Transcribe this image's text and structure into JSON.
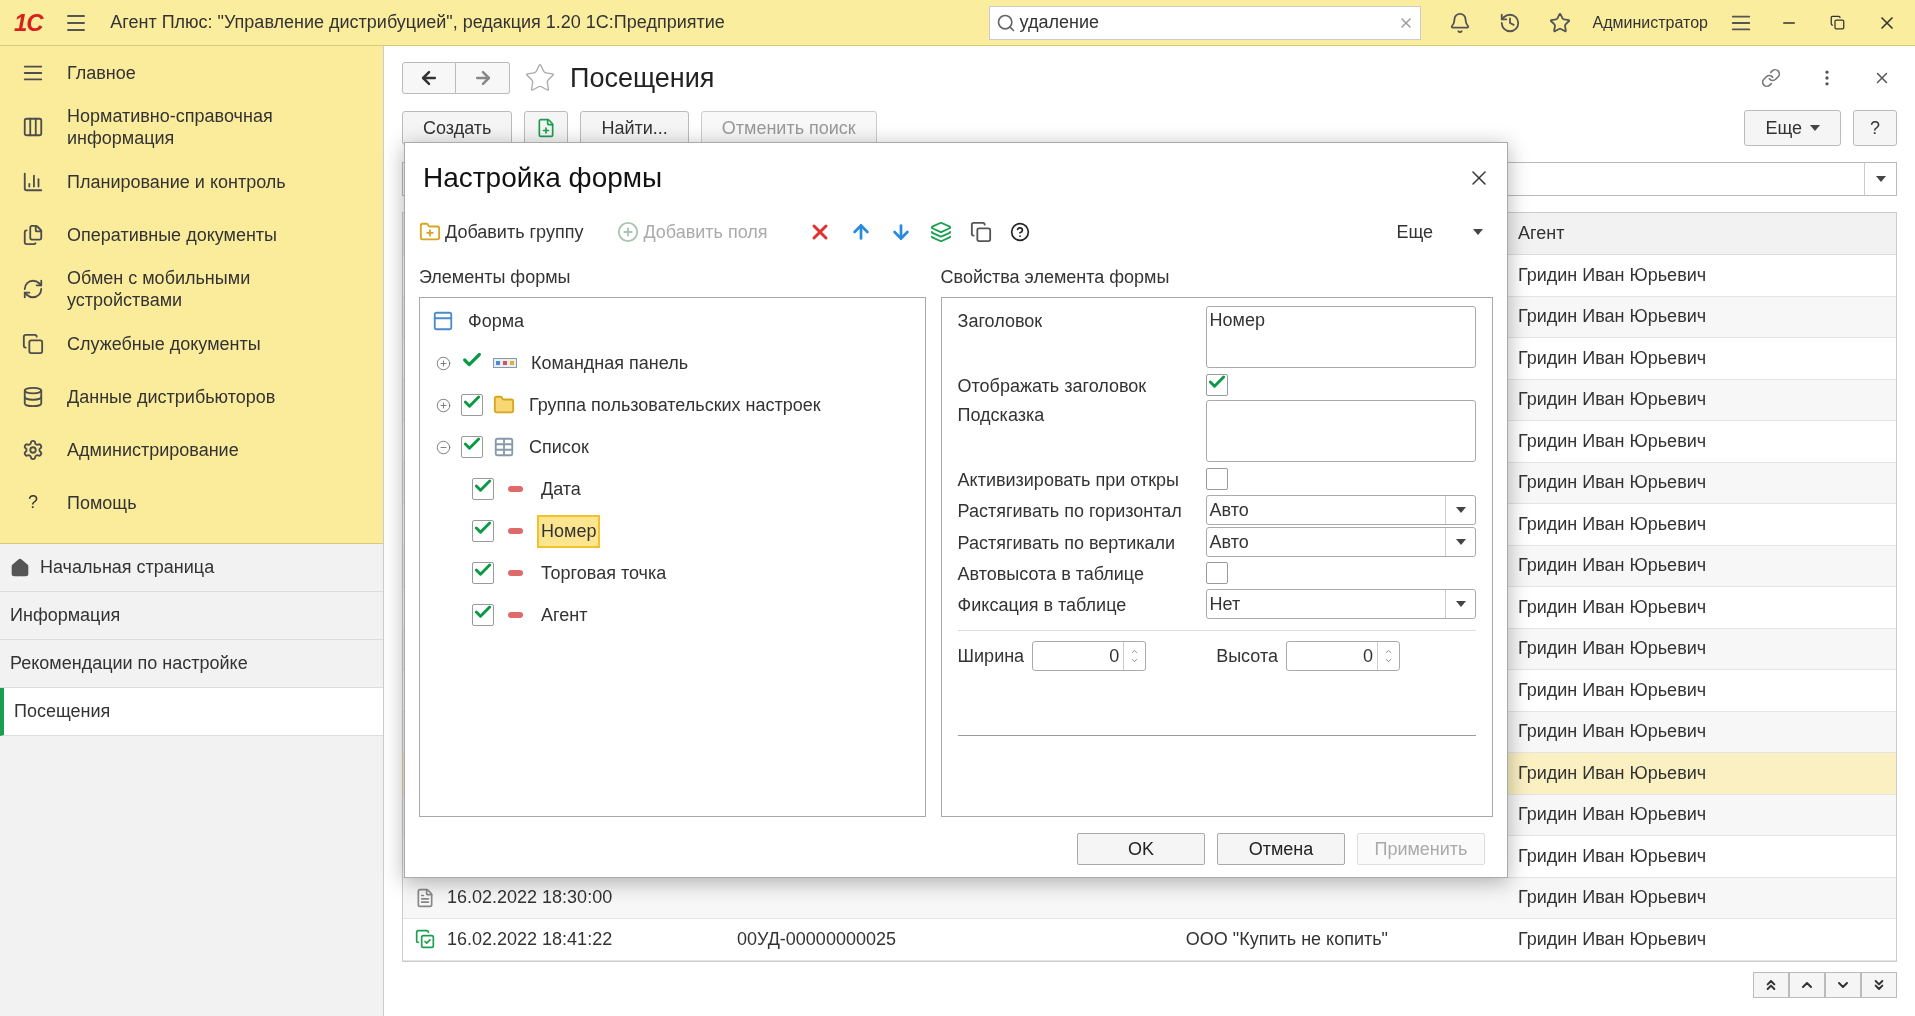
{
  "app_bar": {
    "logo": "1С",
    "title": "Агент Плюс: \"Управление дистрибуцией\", редакция 1.20 1С:Предприятие",
    "search": "удаление",
    "user": "Администратор"
  },
  "sections": [
    {
      "label": "Главное"
    },
    {
      "label": "Нормативно-справочная информация"
    },
    {
      "label": "Планирование и контроль"
    },
    {
      "label": "Оперативные документы"
    },
    {
      "label": "Обмен с мобильными устройствами"
    },
    {
      "label": "Служебные документы"
    },
    {
      "label": "Данные дистрибьюторов"
    },
    {
      "label": "Администрирование"
    },
    {
      "label": "Помощь",
      "glyph": "?"
    }
  ],
  "open_windows": [
    {
      "label": "Начальная страница",
      "selected": false,
      "home": true
    },
    {
      "label": "Информация",
      "selected": false
    },
    {
      "label": "Рекомендации по настройке",
      "selected": false
    },
    {
      "label": "Посещения",
      "selected": true
    }
  ],
  "form": {
    "title": "Посещения",
    "create": "Создать",
    "find": "Найти...",
    "cancel_search": "Отменить поиск",
    "more": "Еще",
    "help": "?",
    "agent_column": "Агент",
    "rows": [
      {
        "agent": "Гридин Иван Юрьевич",
        "selected": false
      },
      {
        "agent": "Гридин Иван Юрьевич",
        "selected": false
      },
      {
        "agent": "Гридин Иван Юрьевич",
        "selected": false
      },
      {
        "agent": "Гридин Иван Юрьевич",
        "selected": false
      },
      {
        "agent": "Гридин Иван Юрьевич",
        "selected": false
      },
      {
        "agent": "Гридин Иван Юрьевич",
        "selected": false
      },
      {
        "agent": "Гридин Иван Юрьевич",
        "selected": false
      },
      {
        "agent": "Гридин Иван Юрьевич",
        "selected": false
      },
      {
        "agent": "Гридин Иван Юрьевич",
        "selected": false
      },
      {
        "agent": "Гридин Иван Юрьевич",
        "selected": false
      },
      {
        "agent": "Гридин Иван Юрьевич",
        "selected": false
      },
      {
        "agent": "Гридин Иван Юрьевич",
        "selected": false
      },
      {
        "agent": "Гридин Иван Юрьевич",
        "selected": true
      },
      {
        "agent": "Гридин Иван Юрьевич",
        "selected": false
      },
      {
        "agent": "Гридин Иван Юрьевич",
        "selected": false
      },
      {
        "date": "16.02.2022 18:30:00",
        "agent": "Гридин Иван Юрьевич",
        "posted": false,
        "selected": false
      },
      {
        "date": "16.02.2022 18:41:22",
        "number": "00УД-00000000025",
        "outlet": "ООО \"Купить не копить\"",
        "agent": "Гридин Иван Юрьевич",
        "posted": true,
        "selected": false
      }
    ]
  },
  "dialog": {
    "title": "Настройка формы",
    "add_group": "Добавить группу",
    "add_fields": "Добавить поля",
    "add_fields_disabled": true,
    "more": "Еще",
    "elements_label": "Элементы формы",
    "properties_label": "Свойства элемента формы",
    "tree": {
      "label": "Форма",
      "kind": "form",
      "children": [
        {
          "label": "Командная панель",
          "kind": "panel",
          "checked": true,
          "expanded": false
        },
        {
          "label": "Группа пользовательских настроек",
          "kind": "group",
          "checked": true,
          "expanded": false
        },
        {
          "label": "Список",
          "kind": "table",
          "checked": true,
          "expanded": true,
          "children": [
            {
              "label": "Дата",
              "kind": "field",
              "checked": true,
              "selected": false
            },
            {
              "label": "Номер",
              "kind": "field",
              "checked": true,
              "selected": true
            },
            {
              "label": "Торговая точка",
              "kind": "field",
              "checked": true,
              "selected": false
            },
            {
              "label": "Агент",
              "kind": "field",
              "checked": true,
              "selected": false
            }
          ]
        }
      ]
    },
    "properties": [
      {
        "kind": "textarea",
        "label": "Заголовок",
        "value": "Номер"
      },
      {
        "kind": "checkbox",
        "label": "Отображать заголовок",
        "checked": true
      },
      {
        "kind": "textarea",
        "label": "Подсказка"
      },
      {
        "kind": "checkbox",
        "label": "Активизировать при откры",
        "checked": false
      },
      {
        "kind": "select",
        "label": "Растягивать по горизонтал",
        "value": "Авто"
      },
      {
        "kind": "select",
        "label": "Растягивать по вертикали",
        "value": "Авто"
      },
      {
        "kind": "checkbox",
        "label": "Автовысота в таблице",
        "checked": false
      },
      {
        "kind": "select",
        "label": "Фиксация в таблице",
        "value": "Нет"
      }
    ],
    "size_fields": [
      {
        "label": "Ширина",
        "value": "0"
      },
      {
        "label": "Высота",
        "value": "0"
      }
    ],
    "buttons": [
      {
        "label": "OK",
        "disabled": false
      },
      {
        "label": "Отмена",
        "disabled": false
      },
      {
        "label": "Применить",
        "disabled": true
      }
    ]
  }
}
